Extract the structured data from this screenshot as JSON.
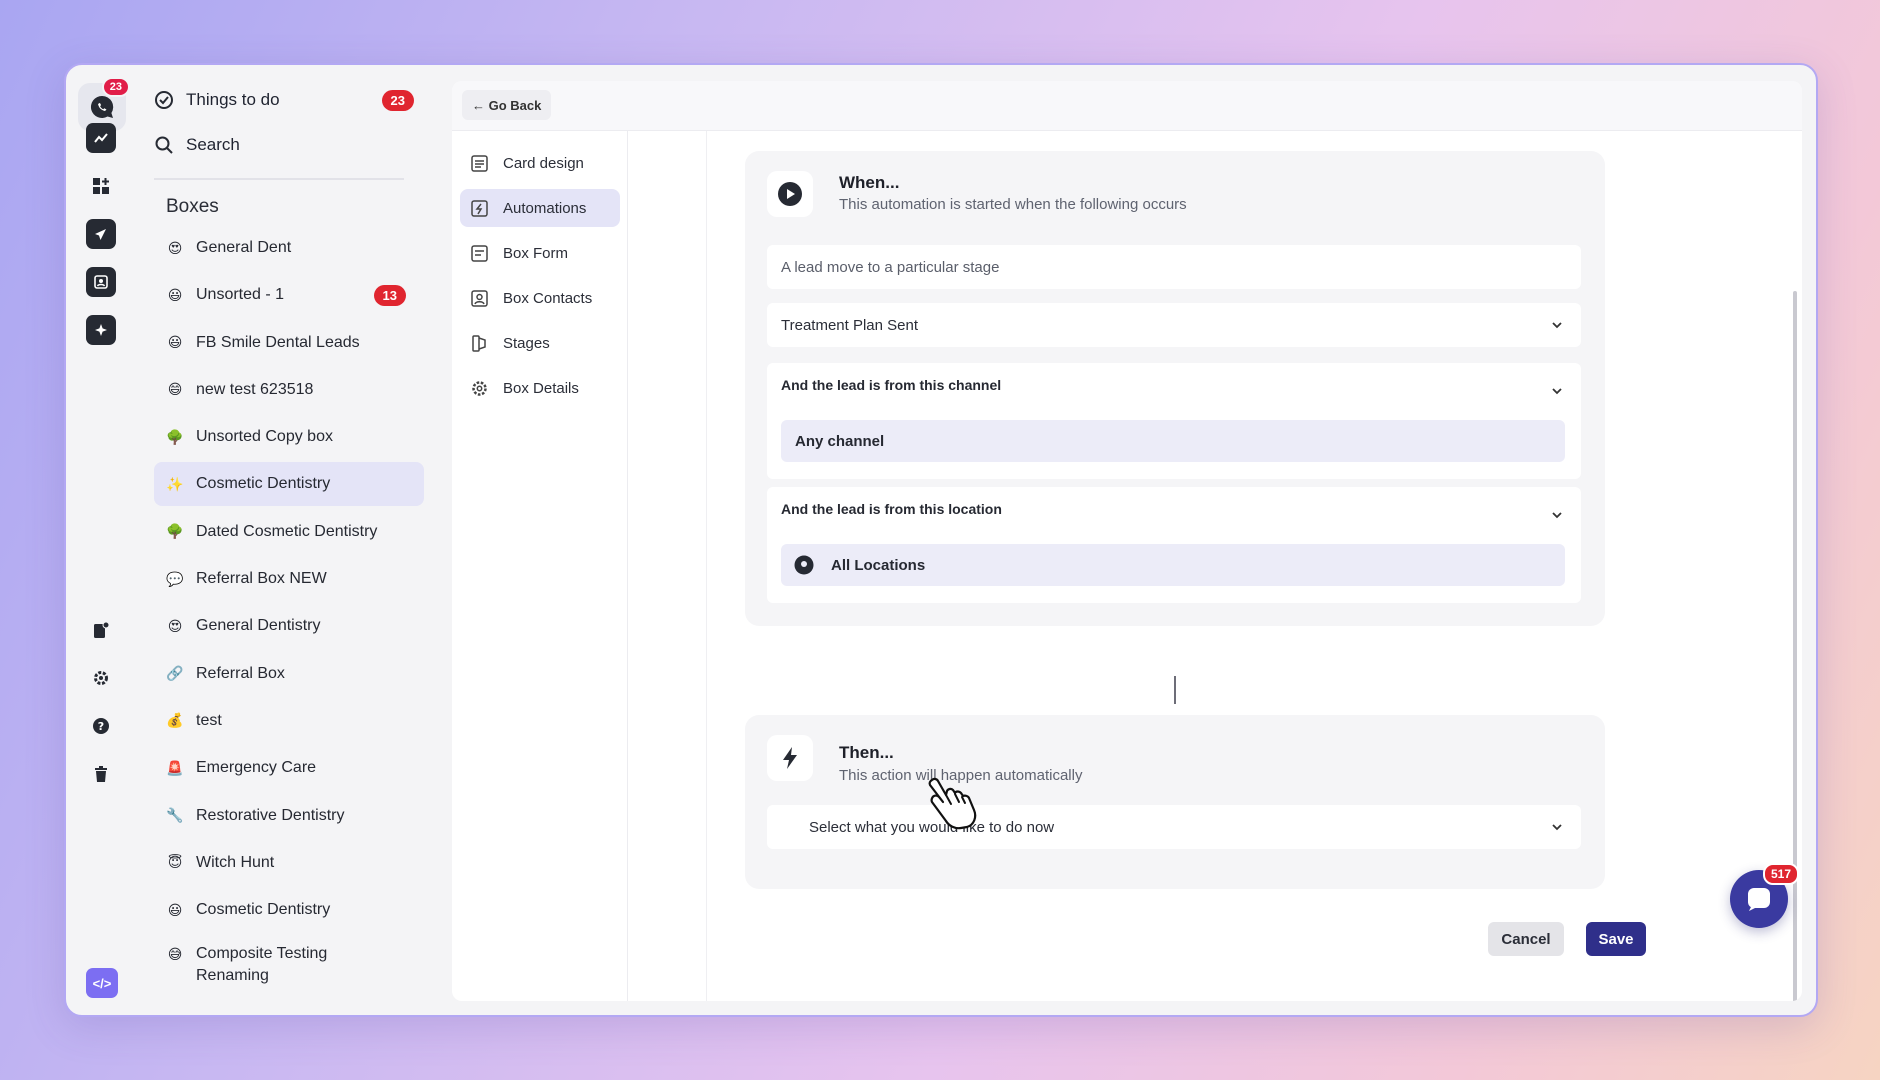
{
  "rail": {
    "logo_badge": "23",
    "code_label": "</>",
    "icons": [
      "analytics-icon",
      "dashboard-icon",
      "send-icon",
      "contacts-icon",
      "sparkle-icon",
      "clipboard-settings-icon",
      "gear-icon",
      "help-icon",
      "trash-icon"
    ]
  },
  "nav": {
    "things_to_do": {
      "label": "Things to do",
      "count": "23"
    },
    "search": {
      "label": "Search"
    },
    "boxes_title": "Boxes",
    "boxes": [
      {
        "emoji": "😍",
        "label": "General Dent",
        "count": ""
      },
      {
        "emoji": "😃",
        "label": "Unsorted - 1",
        "count": "13"
      },
      {
        "emoji": "😃",
        "label": "FB Smile Dental Leads",
        "count": ""
      },
      {
        "emoji": "😄",
        "label": "new test 623518",
        "count": ""
      },
      {
        "emoji": "🌳",
        "label": "Unsorted Copy box",
        "count": ""
      },
      {
        "emoji": "✨",
        "label": "Cosmetic Dentistry",
        "count": ""
      },
      {
        "emoji": "🌳",
        "label": "Dated Cosmetic Dentistry",
        "count": ""
      },
      {
        "emoji": "💬",
        "label": "Referral Box NEW",
        "count": ""
      },
      {
        "emoji": "😍",
        "label": "General Dentistry",
        "count": ""
      },
      {
        "emoji": "🔗",
        "label": "Referral Box",
        "count": ""
      },
      {
        "emoji": "💰",
        "label": "test",
        "count": ""
      },
      {
        "emoji": "🚨",
        "label": "Emergency Care",
        "count": ""
      },
      {
        "emoji": "🔧",
        "label": "Restorative Dentistry",
        "count": ""
      },
      {
        "emoji": "😇",
        "label": "Witch Hunt",
        "count": ""
      },
      {
        "emoji": "😃",
        "label": "Cosmetic Dentistry",
        "count": ""
      },
      {
        "emoji": "😅",
        "label": "Composite Testing Renaming",
        "count": ""
      }
    ]
  },
  "topbar": {
    "go_back": "← Go Back"
  },
  "subnav": {
    "items": [
      {
        "label": "Card design"
      },
      {
        "label": "Automations"
      },
      {
        "label": "Box Form"
      },
      {
        "label": "Box Contacts"
      },
      {
        "label": "Stages"
      },
      {
        "label": "Box Details"
      }
    ]
  },
  "when": {
    "title": "When...",
    "subtitle": "This automation is started when the following occurs",
    "trigger": "A lead move to a particular stage",
    "stage": "Treatment Plan Sent",
    "channel_label": "And the lead is from this channel",
    "channel_value": "Any channel",
    "location_label": "And the lead is from this location",
    "location_value": "All Locations"
  },
  "then": {
    "title": "Then...",
    "subtitle": "This action will happen automatically",
    "action_placeholder": "Select what you would like to do now"
  },
  "actions": {
    "cancel": "Cancel",
    "save": "Save"
  },
  "chat": {
    "badge": "517"
  },
  "colors": {
    "accent": "#2f2f8a",
    "badge": "#e0252f",
    "active_bg": "#e4e4f7"
  }
}
